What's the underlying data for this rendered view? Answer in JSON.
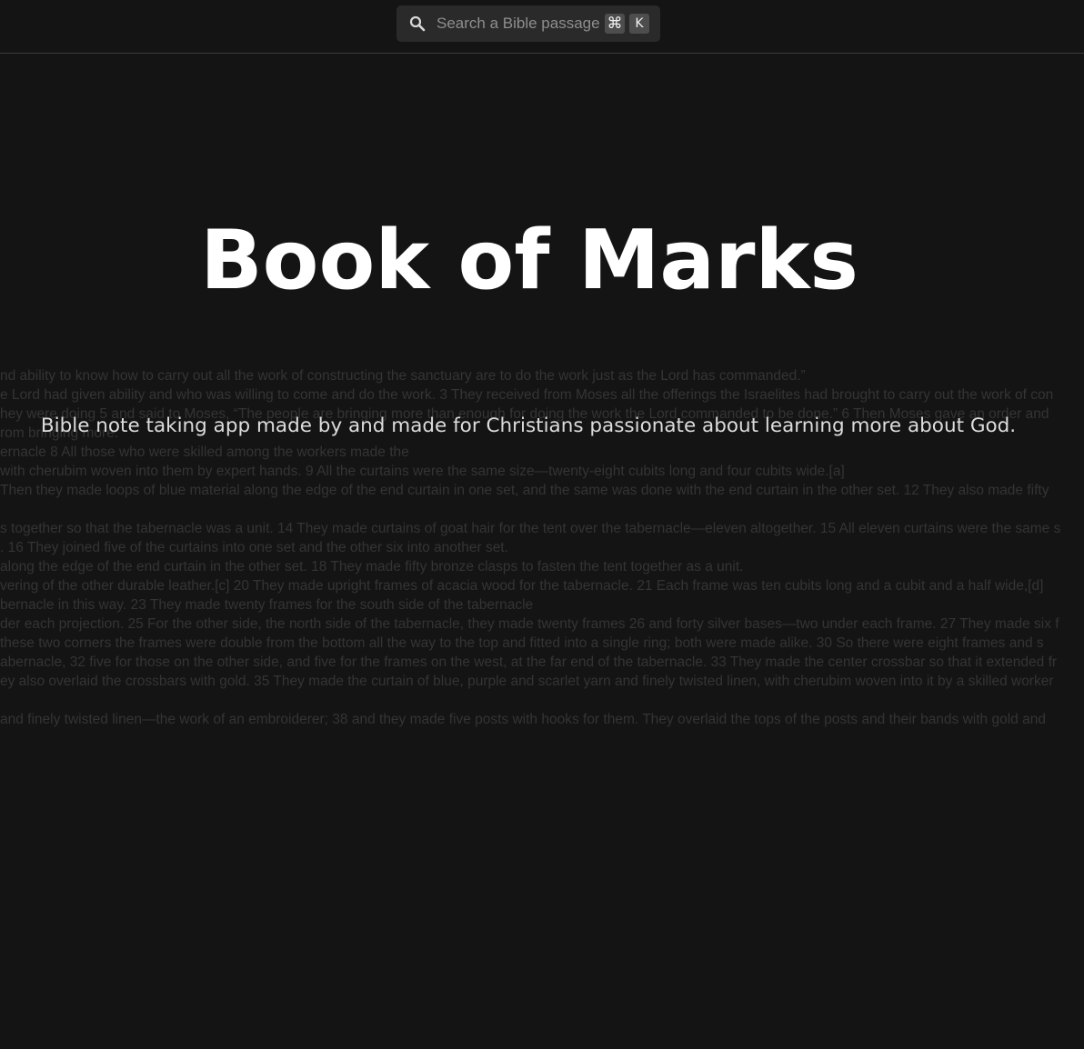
{
  "search": {
    "placeholder": "Search a Bible passage",
    "shortcut_modifier": "⌘",
    "shortcut_key": "K"
  },
  "hero": {
    "title": "Book of Marks",
    "subtitle": "Bible note taking app made by and made for Christians passionate about learning more about God."
  },
  "background_lines": [
    "nd ability to know how to carry out all the work of constructing the sanctuary are to do the work just as the Lord has commanded.”",
    "e Lord had given ability and who was willing to come and do the work. 3 They received from Moses all the offerings the Israelites had brought to carry out the work of con",
    "hey were doing 5 and said to Moses, “The people are bringing more than enough for doing the work the Lord commanded to be done.” 6 Then Moses gave an order and",
    "rom bringing more.",
    "ernacle 8 All those who were skilled among the workers made the",
    "with cherubim woven into them by expert hands. 9 All the curtains were the same size—twenty-eight cubits long and four cubits wide.[a]",
    "Then they made loops of blue material along the edge of the end curtain in one set, and the same was done with the end curtain in the other set. 12 They also made fifty",
    "",
    "s together so that the tabernacle was a unit. 14 They made curtains of goat hair for the tent over the tabernacle—eleven altogether. 15 All eleven curtains were the same s",
    ". 16 They joined five of the curtains into one set and the other six into another set.",
    "along the edge of the end curtain in the other set. 18 They made fifty bronze clasps to fasten the tent together as a unit.",
    "vering of the other durable leather.[c] 20 They made upright frames of acacia wood for the tabernacle. 21 Each frame was ten cubits long and a cubit and a half wide,[d]",
    "bernacle in this way. 23 They made twenty frames for the south side of the tabernacle",
    "der each projection. 25 For the other side, the north side of the tabernacle, they made twenty frames 26 and forty silver bases—two under each frame. 27 They made six f",
    "these two corners the frames were double from the bottom all the way to the top and fitted into a single ring; both were made alike. 30 So there were eight frames and s",
    "abernacle, 32 five for those on the other side, and five for the frames on the west, at the far end of the tabernacle. 33 They made the center crossbar so that it extended fr",
    "ey also overlaid the crossbars with gold. 35 They made the curtain of blue, purple and scarlet yarn and finely twisted linen, with cherubim woven into it by a skilled worker",
    "",
    "and finely twisted linen—the work of an embroiderer; 38 and they made five posts with hooks for them. They overlaid the tops of the posts and their bands with gold and"
  ],
  "colors": {
    "background": "#141414",
    "search_bg": "#2a2a2a",
    "title": "#ffffff",
    "subtitle": "#dcdcdc",
    "faded_text": "#343434"
  },
  "icons": {
    "search": "search-icon"
  }
}
